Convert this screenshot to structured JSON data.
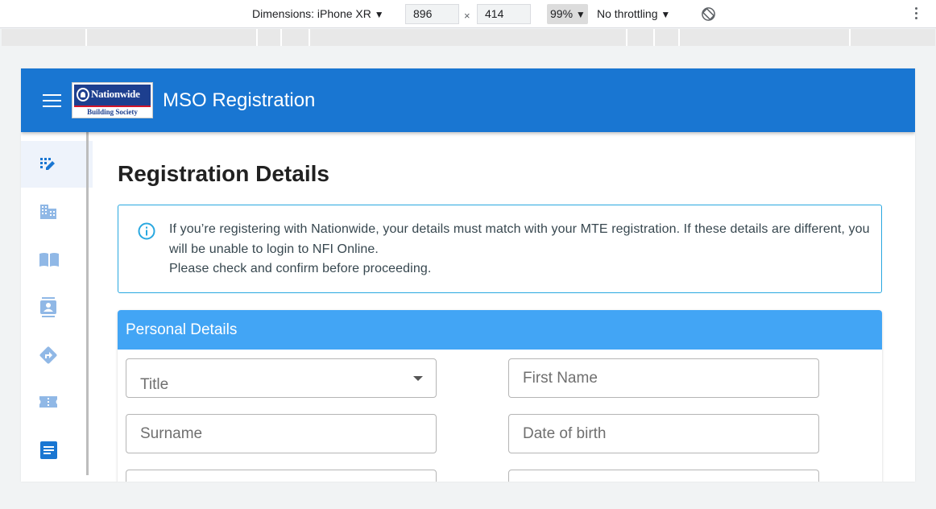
{
  "devtools": {
    "dimensions_label": "Dimensions: iPhone XR",
    "width_value": "896",
    "times": "×",
    "height_value": "414",
    "zoom": "99%",
    "throttling": "No throttling",
    "dropdown_arrow": "▼"
  },
  "app": {
    "title": "MSO Registration",
    "brand_color": "#1976d2",
    "logo": {
      "name": "Nationwide",
      "subtitle": "Building Society"
    }
  },
  "sidebar": {
    "items": [
      {
        "icon": "edit-list-icon",
        "active": true
      },
      {
        "icon": "building-icon",
        "active": false
      },
      {
        "icon": "book-icon",
        "active": false
      },
      {
        "icon": "contact-card-icon",
        "active": false
      },
      {
        "icon": "directions-icon",
        "active": false
      },
      {
        "icon": "ticket-icon",
        "active": false
      },
      {
        "icon": "document-icon",
        "active": false
      }
    ]
  },
  "page": {
    "title": "Registration Details",
    "info_lines": [
      "If you’re registering with Nationwide, your details must match with your MTE registration. If these details are different, you will be unable to login to NFI Online.",
      "Please check and confirm before proceeding."
    ]
  },
  "personal_details": {
    "heading": "Personal Details",
    "heading_color": "#42a5f5",
    "fields": {
      "title_placeholder": "Title",
      "first_name_placeholder": "First Name",
      "surname_placeholder": "Surname",
      "dob_placeholder": "Date of birth"
    }
  }
}
